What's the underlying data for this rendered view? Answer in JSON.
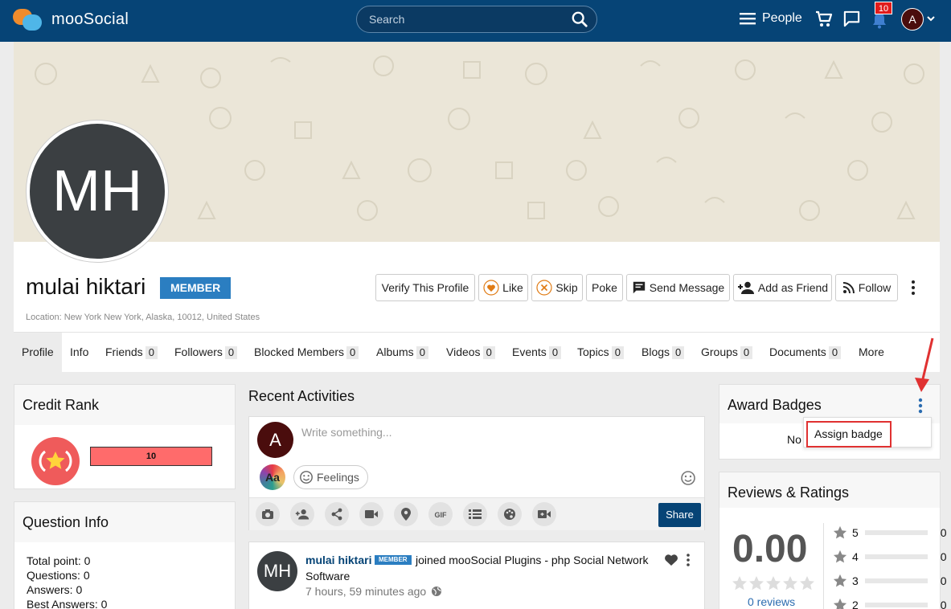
{
  "topbar": {
    "brand": "mooSocial",
    "search_placeholder": "Search",
    "people_label": "People",
    "notification_count": "10",
    "avatar_letter": "A"
  },
  "profile": {
    "avatar_initials": "MH",
    "name": "mulai hiktari",
    "role_badge": "MEMBER",
    "location": "Location: New York New York, Alaska, 10012, United States",
    "actions": {
      "verify": "Verify This Profile",
      "like": "Like",
      "skip": "Skip",
      "poke": "Poke",
      "message": "Send Message",
      "add_friend": "Add as Friend",
      "follow": "Follow"
    }
  },
  "tabs": [
    {
      "label": "Profile"
    },
    {
      "label": "Info"
    },
    {
      "label": "Friends",
      "count": "0"
    },
    {
      "label": "Followers",
      "count": "0"
    },
    {
      "label": "Blocked Members",
      "count": "0"
    },
    {
      "label": "Albums",
      "count": "0"
    },
    {
      "label": "Videos",
      "count": "0"
    },
    {
      "label": "Events",
      "count": "0"
    },
    {
      "label": "Topics",
      "count": "0"
    },
    {
      "label": "Blogs",
      "count": "0"
    },
    {
      "label": "Groups",
      "count": "0"
    },
    {
      "label": "Documents",
      "count": "0"
    },
    {
      "label": "More"
    }
  ],
  "credit_rank": {
    "title": "Credit Rank",
    "value": "10"
  },
  "question_info": {
    "title": "Question Info",
    "lines": [
      "Total point: 0",
      "Questions: 0",
      "Answers: 0",
      "Best Answers: 0"
    ]
  },
  "activities": {
    "title": "Recent Activities",
    "composer_placeholder": "Write something...",
    "aa_label": "Aa",
    "feelings_label": "Feelings",
    "share_label": "Share",
    "feed_item": {
      "avatar_initials": "MH",
      "author": "mulai hiktari",
      "badge": "MEMBER",
      "text_line1": "joined mooSocial Plugins - php Social Network",
      "text_line2": "Software",
      "time": "7 hours, 59 minutes ago"
    }
  },
  "award_badges": {
    "title": "Award Badges",
    "empty_text_visible": "No",
    "menu_item": "Assign badge"
  },
  "reviews": {
    "title": "Reviews & Ratings",
    "average": "0.00",
    "reviews_count": "0 reviews",
    "rows": [
      {
        "star": "5",
        "count": "0"
      },
      {
        "star": "4",
        "count": "0"
      },
      {
        "star": "3",
        "count": "0"
      },
      {
        "star": "2",
        "count": "0"
      }
    ]
  },
  "colors": {
    "topbar": "#064476",
    "badge_blue": "#2b7ec1",
    "rank_red": "#ff6b6b",
    "highlight_red": "#e03131"
  }
}
